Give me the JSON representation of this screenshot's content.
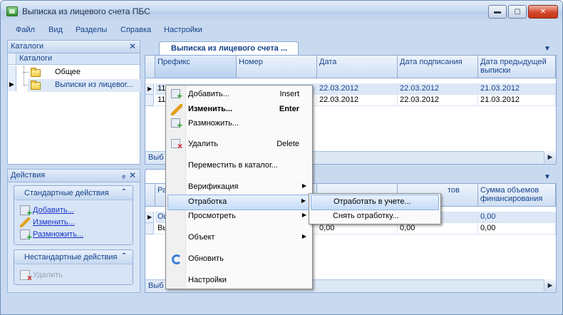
{
  "window": {
    "title": "Выписка из лицевого счета ПБС",
    "minimize_glyph": "▬",
    "maximize_glyph": "▢",
    "close_glyph": "✕"
  },
  "menubar": [
    "Файл",
    "Вид",
    "Разделы",
    "Справка",
    "Настройки"
  ],
  "catalogs_panel": {
    "caption": "Каталоги",
    "close_glyph": "✕",
    "header": "Каталоги",
    "items": [
      "Общее",
      "Выписки из лицевог..."
    ]
  },
  "actions_panel": {
    "caption": "Действия",
    "pin_glyph": "ᵩ",
    "close_glyph": "✕",
    "standard_title": "Стандартные действия",
    "standard_items": [
      "Добавить...",
      "Изменить...",
      "Размножить..."
    ],
    "nonstandard_title": "Нестандартные действия",
    "nonstandard_items": [
      "Удалить"
    ],
    "collapse_glyph": "⌃"
  },
  "top_grid": {
    "tab_label": "Выписка из лицевого счета ...",
    "columns": [
      "Префикс",
      "Номер",
      "Дата",
      "Дата подписания",
      "Дата предыдущей выписки"
    ],
    "rows": [
      [
        "11",
        "",
        "22.03.2012",
        "22.03.2012",
        "21.03.2012"
      ],
      [
        "11",
        "",
        "22.03.2012",
        "22.03.2012",
        "21.03.2012"
      ]
    ],
    "footer": "Выб"
  },
  "bottom_grid": {
    "columns": [
      "Ра",
      "",
      "",
      "тов",
      "Сумма объемов финансирования"
    ],
    "rows": [
      [
        "Ос",
        "",
        "",
        "",
        "0,00"
      ],
      [
        "Вы",
        "",
        "0,00",
        "0,00",
        "0,00"
      ]
    ],
    "footer": "Выб"
  },
  "context_menu": {
    "items": [
      {
        "label": "Добавить...",
        "shortcut": "Insert",
        "icon": "add-icon"
      },
      {
        "label": "Изменить...",
        "shortcut": "Enter",
        "icon": "edit-icon",
        "bold": true
      },
      {
        "label": "Размножить...",
        "shortcut": "",
        "icon": "multiply-icon"
      },
      {
        "label": "Удалить",
        "shortcut": "Delete",
        "icon": "delete-icon"
      },
      {
        "label": "Переместить в каталог...",
        "shortcut": ""
      },
      {
        "label": "Верификация",
        "shortcut": "",
        "submenu": true
      },
      {
        "label": "Отработка",
        "shortcut": "",
        "submenu": true
      },
      {
        "label": "Просмотреть",
        "shortcut": "",
        "submenu": true
      },
      {
        "label": "Объект",
        "shortcut": "",
        "submenu": true
      },
      {
        "label": "Обновить",
        "shortcut": "",
        "icon": "refresh-icon"
      },
      {
        "label": "Настройки",
        "shortcut": ""
      }
    ],
    "submenu_arrow": "▶",
    "submenu": [
      "Отработать в учете...",
      "Снять отработку..."
    ]
  },
  "colors": {
    "accent": "#15428b",
    "highlight": "#c5dcf8",
    "link": "#1a33c8"
  }
}
